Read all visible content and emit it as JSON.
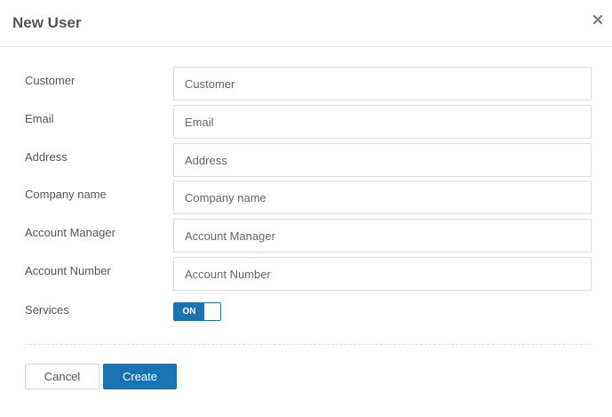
{
  "dialog": {
    "title": "New User",
    "close_icon": "close-icon"
  },
  "form": {
    "fields": [
      {
        "label": "Customer",
        "placeholder": "Customer",
        "value": ""
      },
      {
        "label": "Email",
        "placeholder": "Email",
        "value": ""
      },
      {
        "label": "Address",
        "placeholder": "Address",
        "value": ""
      },
      {
        "label": "Company name",
        "placeholder": "Company name",
        "value": ""
      },
      {
        "label": "Account Manager",
        "placeholder": "Account Manager",
        "value": ""
      },
      {
        "label": "Account Number",
        "placeholder": "Account Number",
        "value": ""
      }
    ],
    "services": {
      "label": "Services",
      "toggle_text": "ON",
      "enabled": true
    }
  },
  "footer": {
    "cancel_label": "Cancel",
    "create_label": "Create"
  },
  "colors": {
    "accent": "#1a73b4",
    "text": "#555555",
    "border": "#dddddd"
  }
}
